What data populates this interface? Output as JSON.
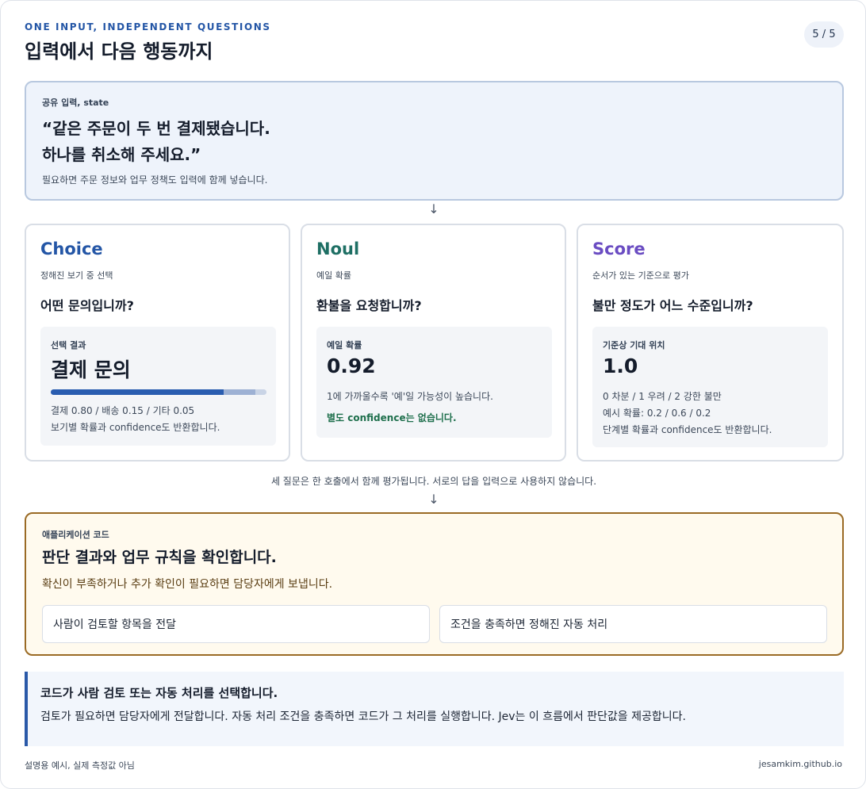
{
  "header": {
    "eyebrow": "ONE INPUT, INDEPENDENT QUESTIONS",
    "title": "입력에서 다음 행동까지",
    "page_indicator": "5 / 5"
  },
  "input": {
    "label": "공유 입력, state",
    "quote_line1": "“같은 주문이 두 번 결제됐습니다.",
    "quote_line2": "하나를 취소해 주세요.”",
    "note": "필요하면 주문 정보와 업무 정책도 입력에 함께 넣습니다."
  },
  "arrow": "↓",
  "tasks": {
    "choice": {
      "name": "Choice",
      "color": "#2456a6",
      "desc": "정해진 보기 중 선택",
      "question": "어떤 문의입니까?",
      "result_label": "선택 결과",
      "result_value": "결제 문의",
      "probabilities": [
        0.8,
        0.15,
        0.05
      ],
      "prob_colors": [
        "#2a5db0",
        "#9db1d4",
        "#c9d4e6"
      ],
      "line1": "결제 0.80 / 배송 0.15 / 기타 0.05",
      "line2": "보기별 확률과 confidence도 반환합니다."
    },
    "noul": {
      "name": "Noul",
      "color": "#1e6f64",
      "desc": "예일 확률",
      "question": "환불을 요청합니까?",
      "result_label": "예일 확률",
      "result_value": "0.92",
      "line1": "1에 가까울수록 '예'일 가능성이 높습니다.",
      "line2": "별도 confidence는 없습니다.",
      "line2_color": "#1e6f4c"
    },
    "score": {
      "name": "Score",
      "color": "#6a4cc2",
      "desc": "순서가 있는 기준으로 평가",
      "question": "불만 정도가 어느 수준입니까?",
      "result_label": "기준상 기대 위치",
      "result_value": "1.0",
      "line1": "0 차분 / 1 우려 / 2 강한 불만",
      "line2": "예시 확률: 0.2 / 0.6 / 0.2",
      "line3": "단계별 확률과 confidence도 반환합니다."
    }
  },
  "mid_note": "세 질문은 한 호출에서 함께 평가됩니다. 서로의 답을 입력으로 사용하지 않습니다.",
  "app": {
    "label": "애플리케이션 코드",
    "title": "판단 결과와 업무 규칙을 확인합니다.",
    "desc": "확신이 부족하거나 추가 확인이 필요하면 담당자에게 보냅니다.",
    "route_human": "사람이 검토할 항목을 전달",
    "route_auto": "조건을 충족하면 정해진 자동 처리"
  },
  "conclusion": {
    "title": "코드가 사람 검토 또는 자동 처리를 선택합니다.",
    "body": "검토가 필요하면 담당자에게 전달합니다. 자동 처리 조건을 충족하면 코드가 그 처리를 실행합니다. Jev는 이 흐름에서 판단값을 제공합니다."
  },
  "footer": {
    "left": "설명용 예시, 실제 측정값 아님",
    "right": "jesamkim.github.io"
  }
}
